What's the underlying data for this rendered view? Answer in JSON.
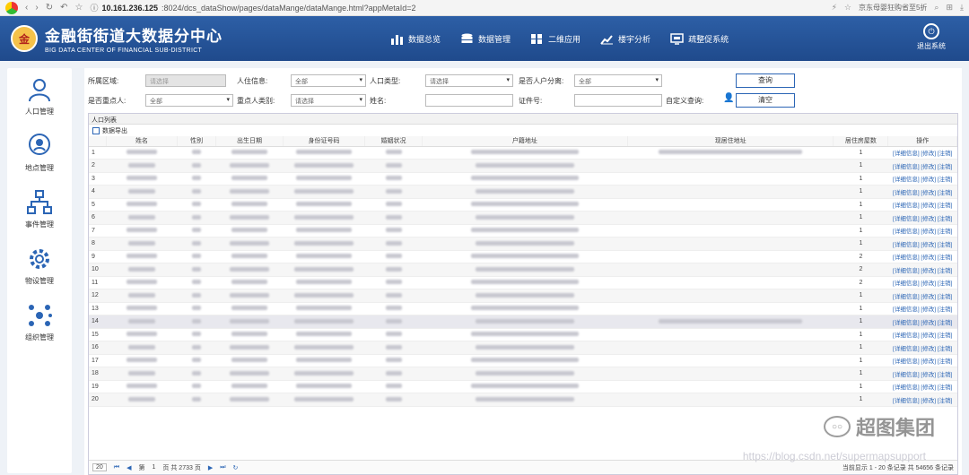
{
  "browser": {
    "url_host": "10.161.236.125",
    "url_rest": ":8024/dcs_dataShow/pages/dataMange/dataMange.html?appMetaId=2",
    "promo": "京东母婴狂购省至5折"
  },
  "header": {
    "title": "金融街街道大数据分中心",
    "subtitle": "BIG DATA CENTER OF FINANCIAL SUB-DISTRICT",
    "nav": [
      {
        "label": "数据总览",
        "icon": "bar-chart-icon"
      },
      {
        "label": "数据管理",
        "icon": "database-icon"
      },
      {
        "label": "二维应用",
        "icon": "grid-icon"
      },
      {
        "label": "楼宇分析",
        "icon": "trend-icon"
      },
      {
        "label": "疏整促系统",
        "icon": "monitor-icon"
      }
    ],
    "exit_label": "退出系统"
  },
  "sidebar": {
    "items": [
      {
        "label": "人口管理",
        "icon": "person-icon"
      },
      {
        "label": "地点管理",
        "icon": "location-icon"
      },
      {
        "label": "事件管理",
        "icon": "hierarchy-icon"
      },
      {
        "label": "物设管理",
        "icon": "gear-icon"
      },
      {
        "label": "组织管理",
        "icon": "network-icon"
      }
    ]
  },
  "filters": {
    "area_label": "所属区域:",
    "area_placeholder": "请选择",
    "residence_label": "人住信息:",
    "residence_value": "全部",
    "population_type_label": "人口类型:",
    "population_type_value": "请选择",
    "separation_label": "是否人户分离:",
    "separation_value": "全部",
    "key_person_label": "是否重点人:",
    "key_person_value": "全部",
    "key_category_label": "重点人类别:",
    "key_category_value": "请选择",
    "name_label": "姓名:",
    "id_label": "证件号:",
    "custom_query_label": "自定义查询:",
    "query_button": "查询",
    "clear_button": "清空"
  },
  "table": {
    "panel_title": "人口列表",
    "export_label": "数据导出",
    "columns": [
      "姓名",
      "性别",
      "出生日期",
      "身份证号码",
      "婚姻状况",
      "户籍地址",
      "现居住地址",
      "居住房屋数",
      "操作"
    ],
    "ops_label": "[详细信息] [修改] [注销]",
    "rows": [
      {
        "no": "1",
        "houses": "1"
      },
      {
        "no": "2",
        "houses": "1"
      },
      {
        "no": "3",
        "houses": "1"
      },
      {
        "no": "4",
        "houses": "1"
      },
      {
        "no": "5",
        "houses": "1"
      },
      {
        "no": "6",
        "houses": "1"
      },
      {
        "no": "7",
        "houses": "1"
      },
      {
        "no": "8",
        "houses": "1"
      },
      {
        "no": "9",
        "houses": "2"
      },
      {
        "no": "10",
        "houses": "2"
      },
      {
        "no": "11",
        "houses": "2"
      },
      {
        "no": "12",
        "houses": "1"
      },
      {
        "no": "13",
        "houses": "1"
      },
      {
        "no": "14",
        "houses": "1"
      },
      {
        "no": "15",
        "houses": "1"
      },
      {
        "no": "16",
        "houses": "1"
      },
      {
        "no": "17",
        "houses": "1"
      },
      {
        "no": "18",
        "houses": "1"
      },
      {
        "no": "19",
        "houses": "1"
      },
      {
        "no": "20",
        "houses": "1"
      }
    ]
  },
  "pager": {
    "page_size": "20",
    "page_prefix": "第",
    "page_value": "1",
    "page_suffix": "页 共 2733 页",
    "summary": "当前显示 1 - 20 条记录 共 54656 条记录"
  },
  "watermark": {
    "brand": "超图集团",
    "url": "https://blog.csdn.net/supermapsupport"
  }
}
